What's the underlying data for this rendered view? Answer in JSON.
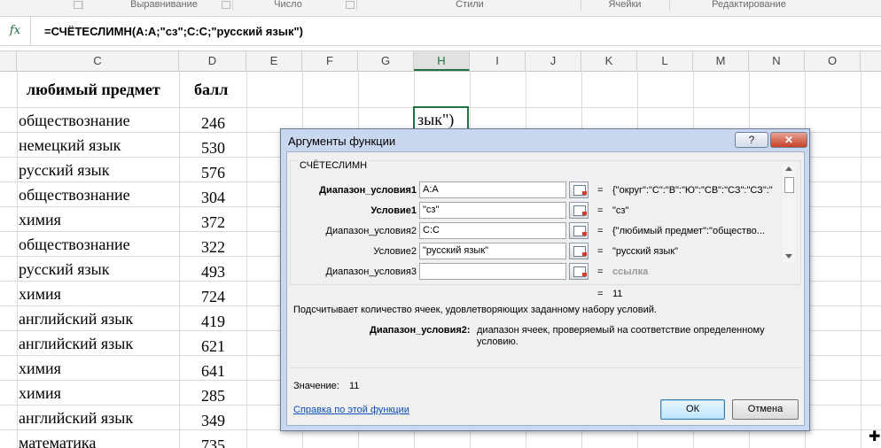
{
  "ribbon": {
    "groups": [
      "Выравнивание",
      "Число",
      "Стили",
      "Ячейки",
      "Редактирование"
    ]
  },
  "formula_bar": {
    "fx_label": "fx",
    "formula": "=СЧЁТЕСЛИМН(A:A;\"сз\";C:C;\"русский язык\")"
  },
  "columns": [
    "C",
    "D",
    "E",
    "F",
    "G",
    "H",
    "I",
    "J",
    "K",
    "L",
    "M",
    "N",
    "O"
  ],
  "selected_column": "H",
  "sheet": {
    "header_c": "любимый предмет",
    "header_d": "балл",
    "rows": [
      {
        "c": "обществознание",
        "d": "246"
      },
      {
        "c": "немецкий язык",
        "d": "530"
      },
      {
        "c": "русский язык",
        "d": "576"
      },
      {
        "c": "обществознание",
        "d": "304"
      },
      {
        "c": "химия",
        "d": "372"
      },
      {
        "c": "обществознание",
        "d": "322"
      },
      {
        "c": "русский язык",
        "d": "493"
      },
      {
        "c": "химия",
        "d": "724"
      },
      {
        "c": "английский язык",
        "d": "419"
      },
      {
        "c": "английский язык",
        "d": "621"
      },
      {
        "c": "химия",
        "d": "641"
      },
      {
        "c": "химия",
        "d": "285"
      },
      {
        "c": "английский язык",
        "d": "349"
      },
      {
        "c": "математика",
        "d": "735"
      }
    ],
    "active_cell_text": "зык\")"
  },
  "dialog": {
    "title": "Аргументы функции",
    "help_button": "?",
    "close_button": "✕",
    "function_name": "СЧЁТЕСЛИМН",
    "args": [
      {
        "label": "Диапазон_условия1",
        "value": "A:A",
        "result": "{\"округ\":\"С\":\"В\":\"Ю\":\"СВ\":\"СЗ\":\"СЗ\":\"",
        "bold": true
      },
      {
        "label": "Условие1",
        "value": "\"сз\"",
        "result": "\"сз\"",
        "bold": true
      },
      {
        "label": "Диапазон_условия2",
        "value": "C:C",
        "result": "{\"любимый предмет\":\"общество...",
        "bold": false
      },
      {
        "label": "Условие2",
        "value": "\"русский язык\"",
        "result": "\"русский язык\"",
        "bold": false
      },
      {
        "label": "Диапазон_условия3",
        "value": "",
        "result": "ссылка",
        "bold": false
      }
    ],
    "equals": "=",
    "total_result": "11",
    "description": "Подсчитывает количество ячеек, удовлетворяющих заданному набору условий.",
    "arg_help_name": "Диапазон_условия2:",
    "arg_help_text_1": "диапазон ячеек, проверяемый на соответствие определенному",
    "arg_help_text_2": "условию.",
    "value_label": "Значение:",
    "value": "11",
    "help_link": "Справка по этой функции",
    "ok_label": "ОК",
    "cancel_label": "Отмена"
  }
}
